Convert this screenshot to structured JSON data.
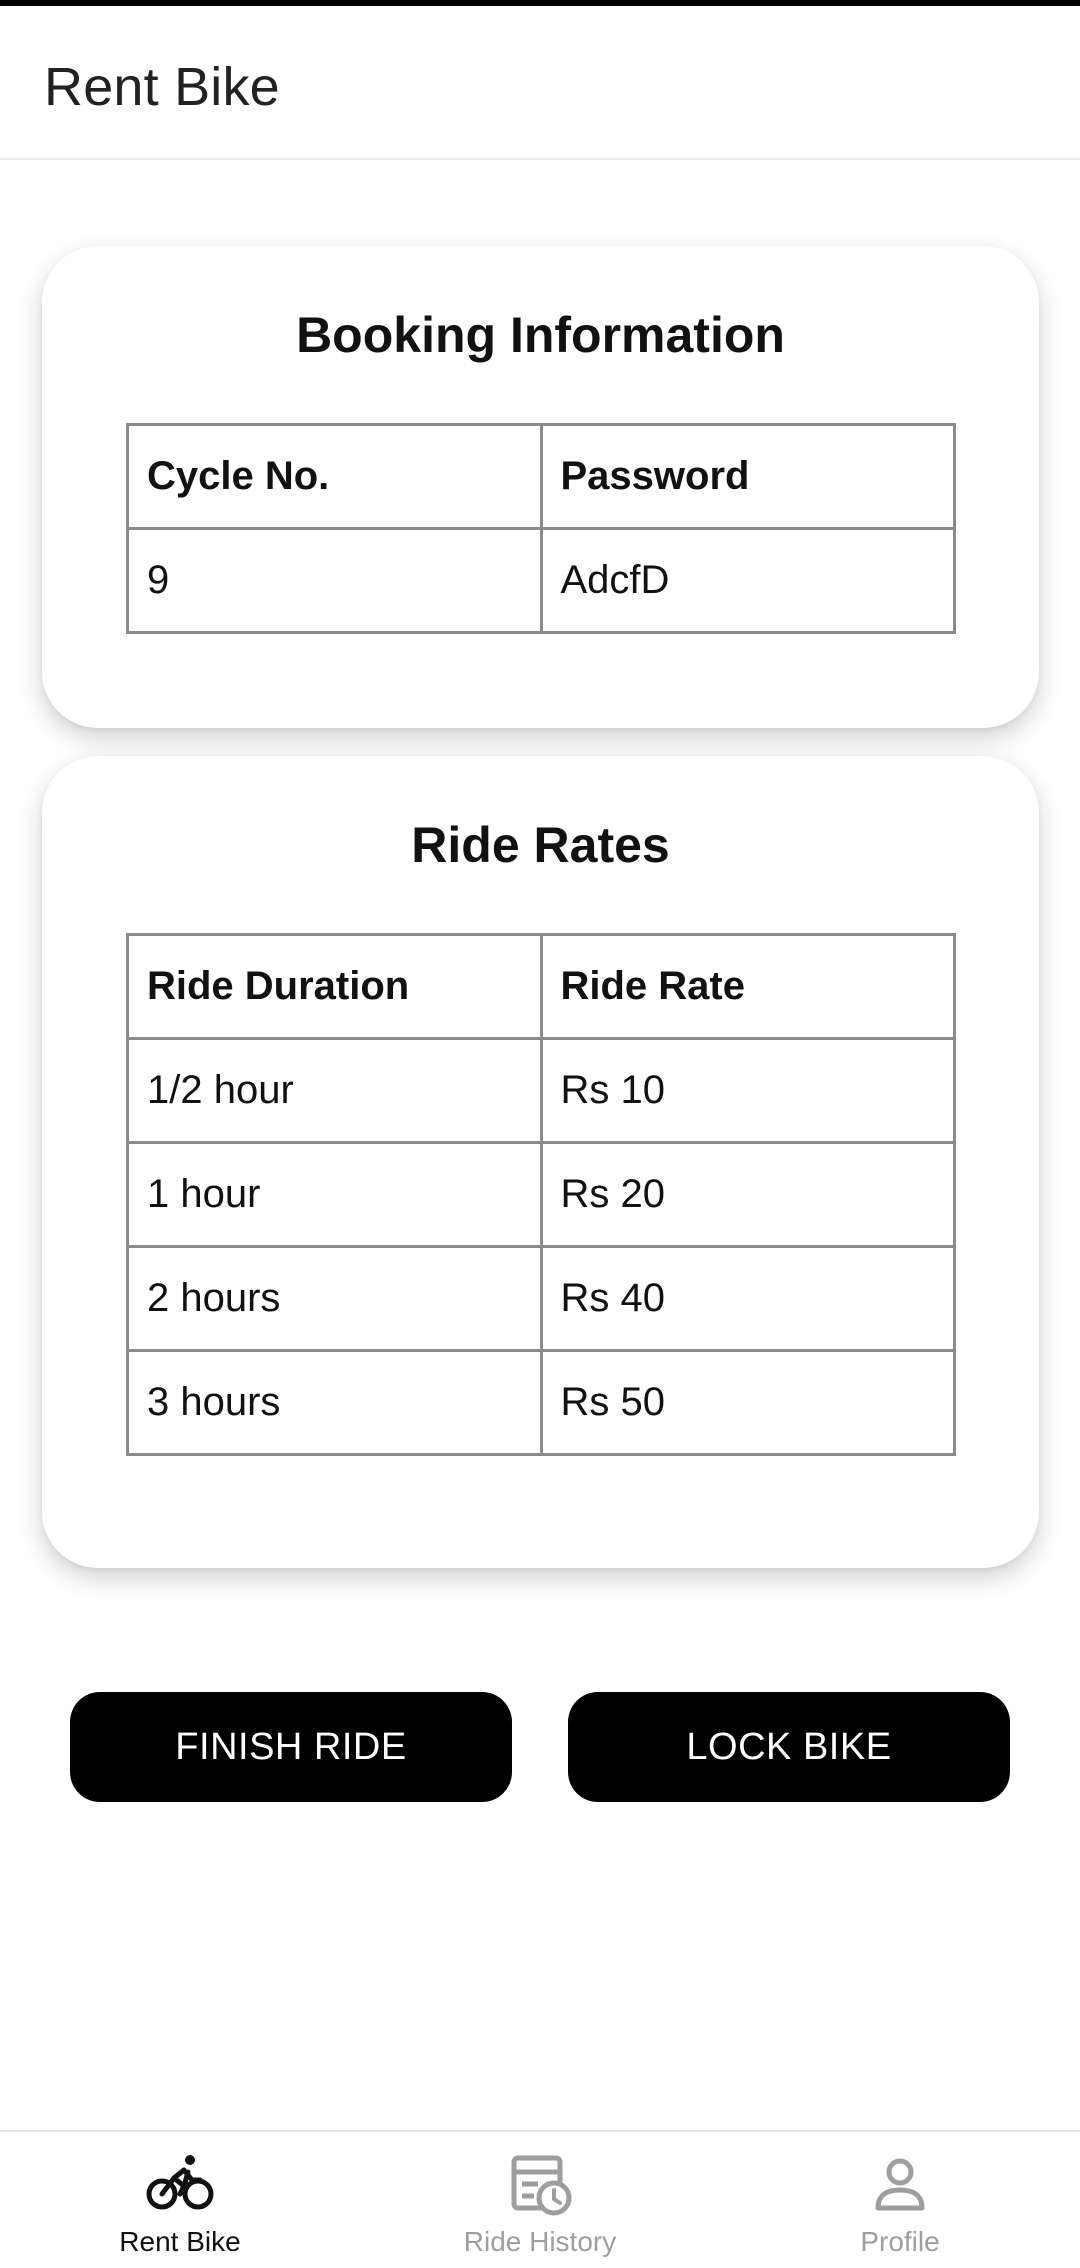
{
  "header": {
    "title": "Rent Bike"
  },
  "booking": {
    "title": "Booking Information",
    "columns": [
      "Cycle No.",
      "Password"
    ],
    "row": [
      "9",
      "AdcfD"
    ]
  },
  "rates": {
    "title": "Ride Rates",
    "columns": [
      "Ride Duration",
      "Ride Rate"
    ],
    "rows": [
      [
        "1/2 hour",
        "Rs 10"
      ],
      [
        "1 hour",
        "Rs 20"
      ],
      [
        "2 hours",
        "Rs 40"
      ],
      [
        "3 hours",
        "Rs 50"
      ]
    ]
  },
  "actions": {
    "finish_label": "FINISH RIDE",
    "lock_label": "LOCK BIKE"
  },
  "nav": {
    "items": [
      {
        "label": "Rent Bike",
        "icon": "bicycle-icon",
        "active": true
      },
      {
        "label": "Ride History",
        "icon": "history-icon",
        "active": false
      },
      {
        "label": "Profile",
        "icon": "person-icon",
        "active": false
      }
    ]
  },
  "colors": {
    "button_bg": "#000000",
    "button_text": "#ffffff",
    "nav_active": "#111111",
    "nav_inactive": "#9e9e9e"
  }
}
